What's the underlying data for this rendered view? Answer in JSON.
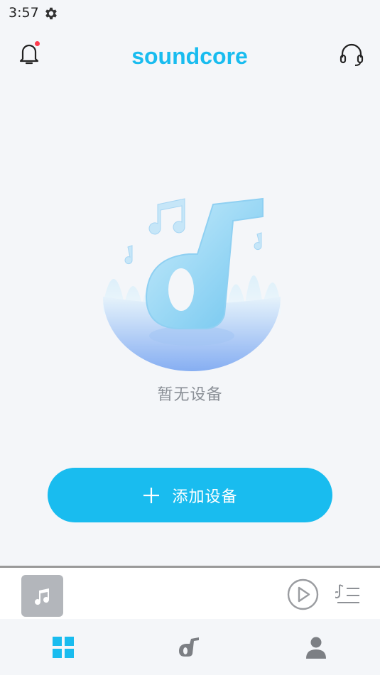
{
  "status_bar": {
    "time": "3:57",
    "gear_icon": "gear-icon"
  },
  "header": {
    "logo_text": "soundcore",
    "brand_color": "#19bcef",
    "notification_badge_color": "#ff3b4d",
    "left_icon": "bell-icon",
    "right_icon": "headset-icon"
  },
  "empty_state": {
    "message": "暂无设备"
  },
  "actions": {
    "add_device_label": "添加设备",
    "add_device_icon": "plus-icon"
  },
  "mini_player": {
    "artwork_icon": "music-note-icon",
    "play_icon": "play-circle-icon",
    "queue_icon": "playlist-icon"
  },
  "bottom_nav": {
    "items": [
      {
        "icon": "grid-icon",
        "active": true,
        "color": "#19bcef"
      },
      {
        "icon": "soundcore-note-icon",
        "active": false,
        "color": "#7c7f84"
      },
      {
        "icon": "profile-icon",
        "active": false,
        "color": "#7c7f84"
      }
    ]
  }
}
